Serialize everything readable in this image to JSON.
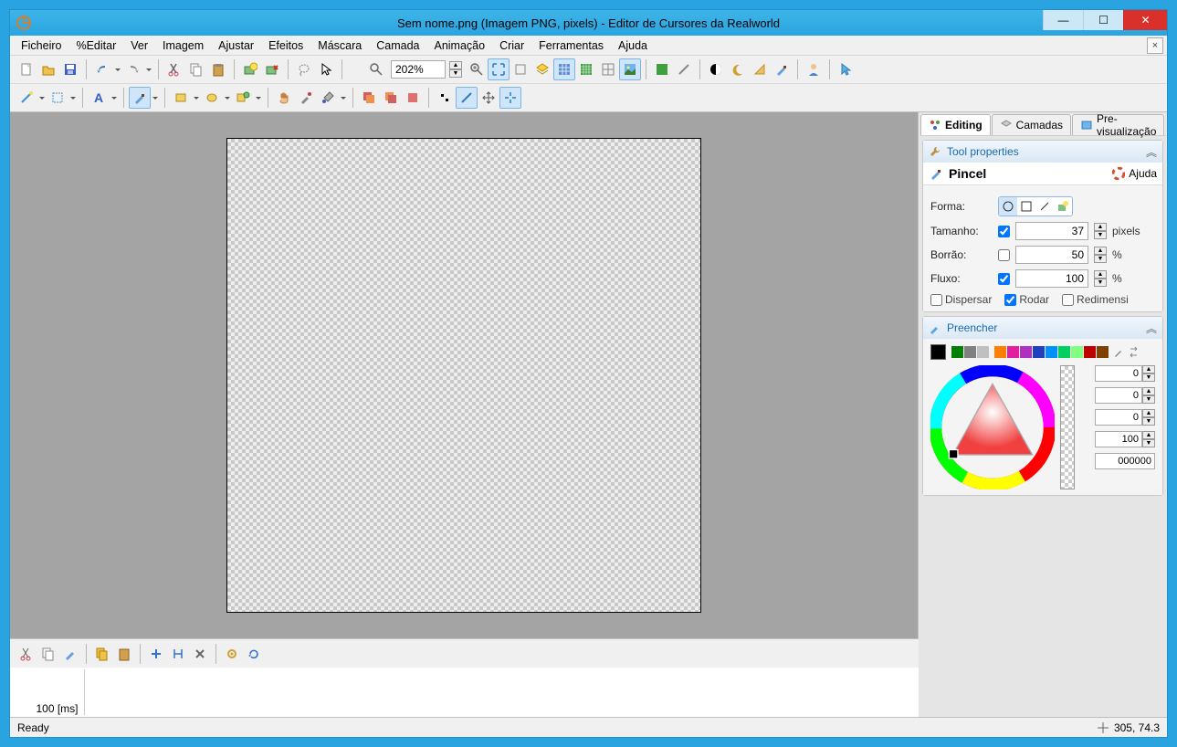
{
  "window": {
    "title": "Sem nome.png (Imagem PNG, pixels) - Editor de Cursores da Realworld"
  },
  "menubar": [
    "Ficheiro",
    "%Editar",
    "Ver",
    "Imagem",
    "Ajustar",
    "Efeitos",
    "Máscara",
    "Camada",
    "Animação",
    "Criar",
    "Ferramentas",
    "Ajuda"
  ],
  "zoom": {
    "value": "202%"
  },
  "right_tabs": {
    "editing": "Editing",
    "layers": "Camadas",
    "preview": "Pre-visualização"
  },
  "tool_props": {
    "panel_title": "Tool properties",
    "tool_name": "Pincel",
    "help_label": "Ajuda",
    "shape_label": "Forma:",
    "size_label": "Tamanho:",
    "size_value": "37",
    "size_unit": "pixels",
    "blur_label": "Borrão:",
    "blur_value": "50",
    "blur_unit": "%",
    "flow_label": "Fluxo:",
    "flow_value": "100",
    "flow_unit": "%",
    "scatter_label": "Dispersar",
    "rotate_label": "Rodar",
    "resize_label": "Redimensi"
  },
  "fill_panel": {
    "title": "Preencher",
    "swatches": [
      "#000000",
      "#008000",
      "#808080",
      "#c0c0c0",
      "#ff8000",
      "#e020a0",
      "#b030c0",
      "#2040c0",
      "#0090ff",
      "#00d060",
      "#80ff80",
      "#c00000",
      "#804000"
    ],
    "val1": "0",
    "val2": "0",
    "val3": "0",
    "alpha": "100",
    "hex": "000000"
  },
  "timeline": {
    "frame_label": "100 [ms]"
  },
  "status": {
    "left": "Ready",
    "coords": "305, 74.3"
  }
}
